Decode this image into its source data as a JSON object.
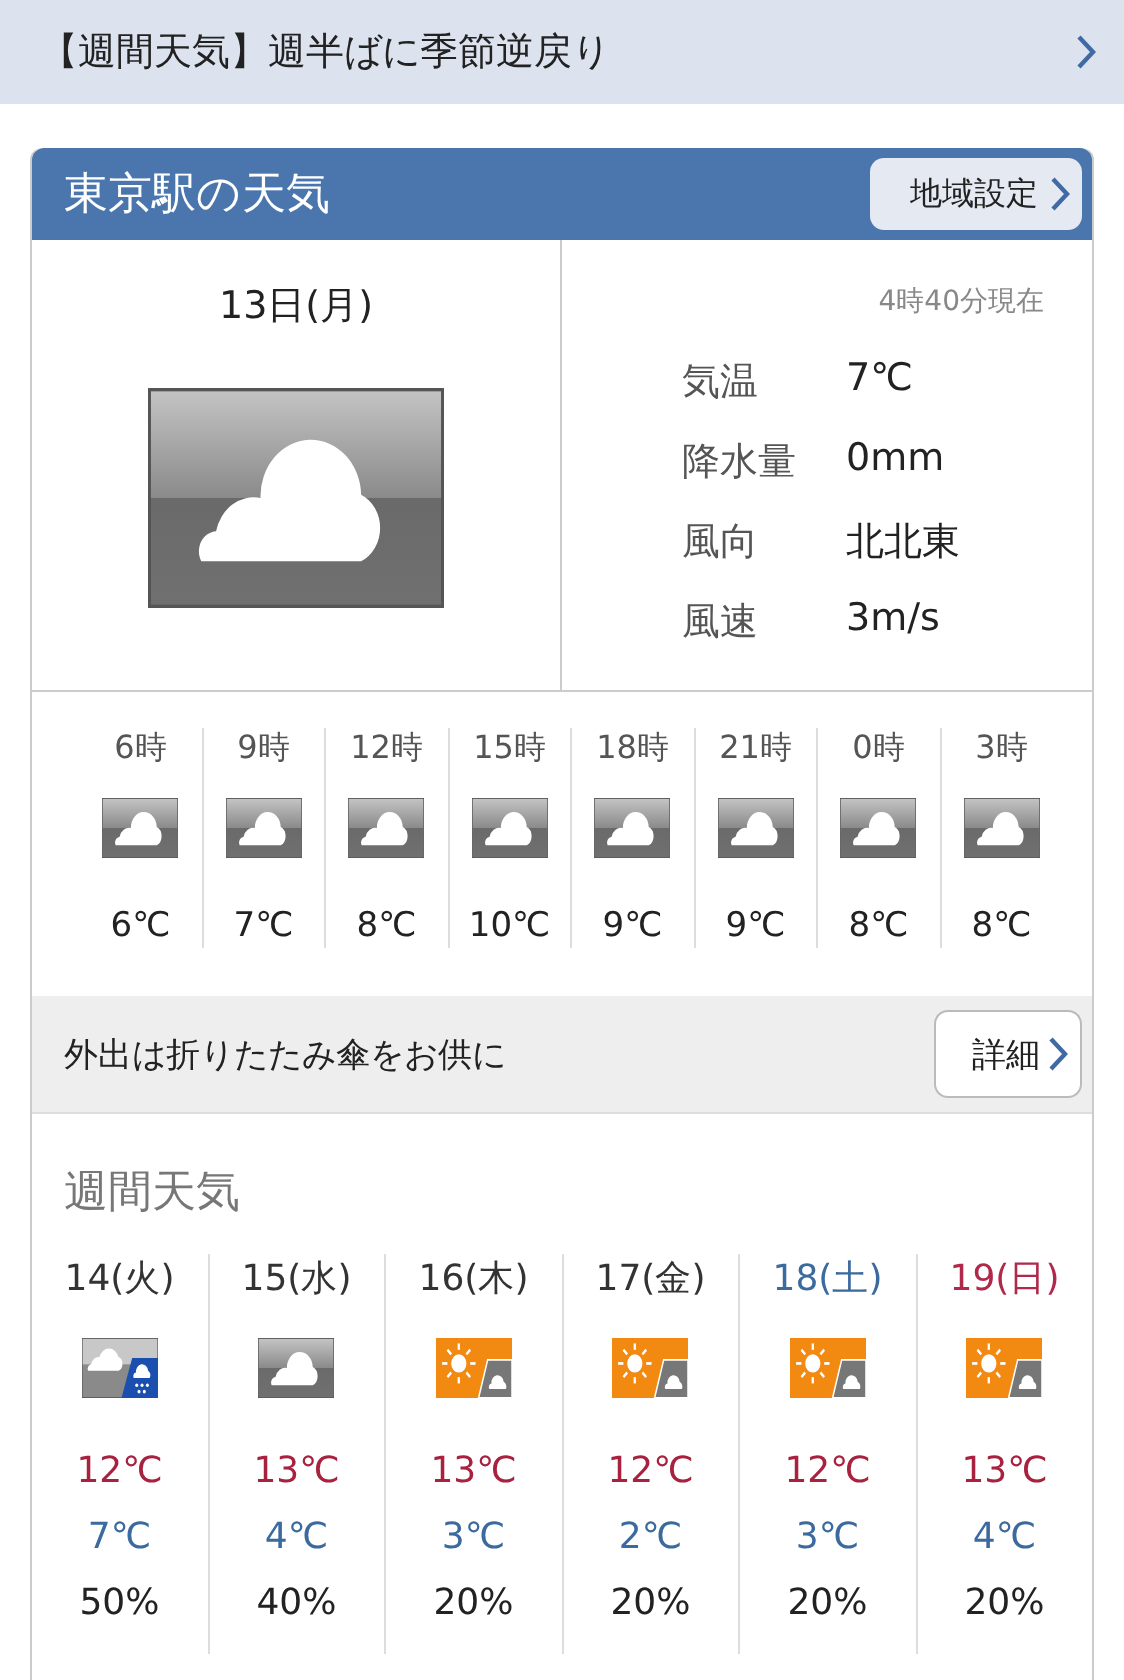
{
  "headline": {
    "text": "【週間天気】週半ばに季節逆戻り"
  },
  "card": {
    "title": "東京駅の天気",
    "region_button": "地域設定"
  },
  "current": {
    "date": "13日(月)",
    "observed": "4時40分現在",
    "kind": "cloudy",
    "details": [
      {
        "label": "気温",
        "value": "7℃"
      },
      {
        "label": "降水量",
        "value": "0mm"
      },
      {
        "label": "風向",
        "value": "北北東"
      },
      {
        "label": "風速",
        "value": "3m/s"
      }
    ]
  },
  "hourly": [
    {
      "time": "6時",
      "kind": "cloudy",
      "temp": "6℃"
    },
    {
      "time": "9時",
      "kind": "cloudy",
      "temp": "7℃"
    },
    {
      "time": "12時",
      "kind": "cloudy",
      "temp": "8℃"
    },
    {
      "time": "15時",
      "kind": "cloudy",
      "temp": "10℃"
    },
    {
      "time": "18時",
      "kind": "cloudy",
      "temp": "9℃"
    },
    {
      "time": "21時",
      "kind": "cloudy",
      "temp": "9℃"
    },
    {
      "time": "0時",
      "kind": "cloudy",
      "temp": "8℃"
    },
    {
      "time": "3時",
      "kind": "cloudy",
      "temp": "8℃"
    }
  ],
  "advice": {
    "text": "外出は折りたたみ傘をお供に",
    "button": "詳細"
  },
  "weekly": {
    "title": "週間天気",
    "days": [
      {
        "date": "14(火)",
        "color": "#333333",
        "kind": "cloudy_then_rain",
        "high": "12℃",
        "low": "7℃",
        "precip": "50%"
      },
      {
        "date": "15(水)",
        "color": "#333333",
        "kind": "cloudy",
        "high": "13℃",
        "low": "4℃",
        "precip": "40%"
      },
      {
        "date": "16(木)",
        "color": "#333333",
        "kind": "sunny_then_cloudy",
        "high": "13℃",
        "low": "3℃",
        "precip": "20%"
      },
      {
        "date": "17(金)",
        "color": "#333333",
        "kind": "sunny_then_cloudy",
        "high": "12℃",
        "low": "2℃",
        "precip": "20%"
      },
      {
        "date": "18(土)",
        "color": "#3b6a9e",
        "kind": "sunny_then_cloudy",
        "high": "12℃",
        "low": "3℃",
        "precip": "20%"
      },
      {
        "date": "19(日)",
        "color": "#b0284a",
        "kind": "sunny_then_cloudy",
        "high": "13℃",
        "low": "4℃",
        "precip": "20%"
      }
    ]
  }
}
